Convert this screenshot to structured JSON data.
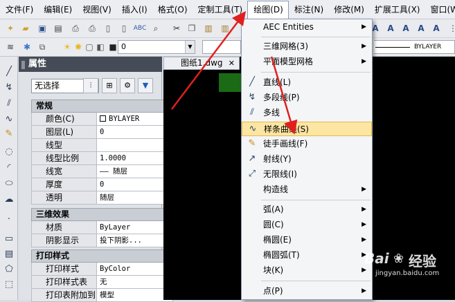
{
  "menubar": {
    "items": [
      {
        "label": "文件(F)"
      },
      {
        "label": "编辑(E)"
      },
      {
        "label": "视图(V)"
      },
      {
        "label": "插入(I)"
      },
      {
        "label": "格式(O)"
      },
      {
        "label": "定制工具(T)"
      },
      {
        "label": "绘图(D)"
      },
      {
        "label": "标注(N)"
      },
      {
        "label": "修改(M)"
      },
      {
        "label": "扩展工具(X)"
      },
      {
        "label": "窗口(W)"
      }
    ],
    "active_index": 6
  },
  "toolbar2": {
    "layer_value": "0",
    "linetype_value": "BYLAYER"
  },
  "properties": {
    "title": "属性",
    "selection": "无选择",
    "sections": [
      {
        "title": "常规",
        "rows": [
          {
            "key": "颜色(C)",
            "value": "BYLAYER"
          },
          {
            "key": "图层(L)",
            "value": "0"
          },
          {
            "key": "线型",
            "value": ""
          },
          {
            "key": "线型比例",
            "value": "1.0000"
          },
          {
            "key": "线宽",
            "value": "—— 随层"
          },
          {
            "key": "厚度",
            "value": "0"
          },
          {
            "key": "透明",
            "value": "随层"
          }
        ]
      },
      {
        "title": "三维效果",
        "rows": [
          {
            "key": "材质",
            "value": "ByLayer"
          },
          {
            "key": "阴影显示",
            "value": "投下阴影..."
          }
        ]
      },
      {
        "title": "打印样式",
        "rows": [
          {
            "key": "打印样式",
            "value": "ByColor"
          },
          {
            "key": "打印样式表",
            "value": "无"
          },
          {
            "key": "打印表附加到",
            "value": "模型"
          }
        ]
      }
    ]
  },
  "document_tab": {
    "label": "图纸1.dwg",
    "close": "✕"
  },
  "draw_menu": {
    "items": [
      {
        "label": "AEC Entities",
        "submenu": true,
        "icon": ""
      },
      {
        "label": "三维网格(3)",
        "submenu": true,
        "icon": ""
      },
      {
        "label": "平面模型网格",
        "submenu": true,
        "icon": ""
      },
      {
        "label": "直线(L)",
        "submenu": false,
        "icon": "line-icon"
      },
      {
        "label": "多段线(P)",
        "submenu": false,
        "icon": "polyline-icon"
      },
      {
        "label": "多线",
        "submenu": false,
        "icon": "multiline-icon"
      },
      {
        "label": "样条曲线(S)",
        "submenu": false,
        "icon": "spline-icon",
        "highlighted": true
      },
      {
        "label": "徒手画线(F)",
        "submenu": false,
        "icon": "freehand-icon"
      },
      {
        "label": "射线(Y)",
        "submenu": false,
        "icon": "ray-icon"
      },
      {
        "label": "无限线(I)",
        "submenu": false,
        "icon": "xline-icon"
      },
      {
        "label": "构造线",
        "submenu": true,
        "icon": ""
      },
      {
        "label": "弧(A)",
        "submenu": true,
        "icon": ""
      },
      {
        "label": "圆(C)",
        "submenu": true,
        "icon": ""
      },
      {
        "label": "椭圆(E)",
        "submenu": true,
        "icon": ""
      },
      {
        "label": "椭圆弧(T)",
        "submenu": true,
        "icon": ""
      },
      {
        "label": "块(K)",
        "submenu": true,
        "icon": ""
      },
      {
        "label": "点(P)",
        "submenu": true,
        "icon": ""
      }
    ]
  },
  "watermark": {
    "brand": "Bai",
    "brand2": "经验",
    "url": "jingyan.baidu.com"
  },
  "colors": {
    "highlight": "#fde6a3",
    "arrow_red": "#e0201e",
    "canvas": "#000000",
    "panel_title": "#454c57"
  }
}
